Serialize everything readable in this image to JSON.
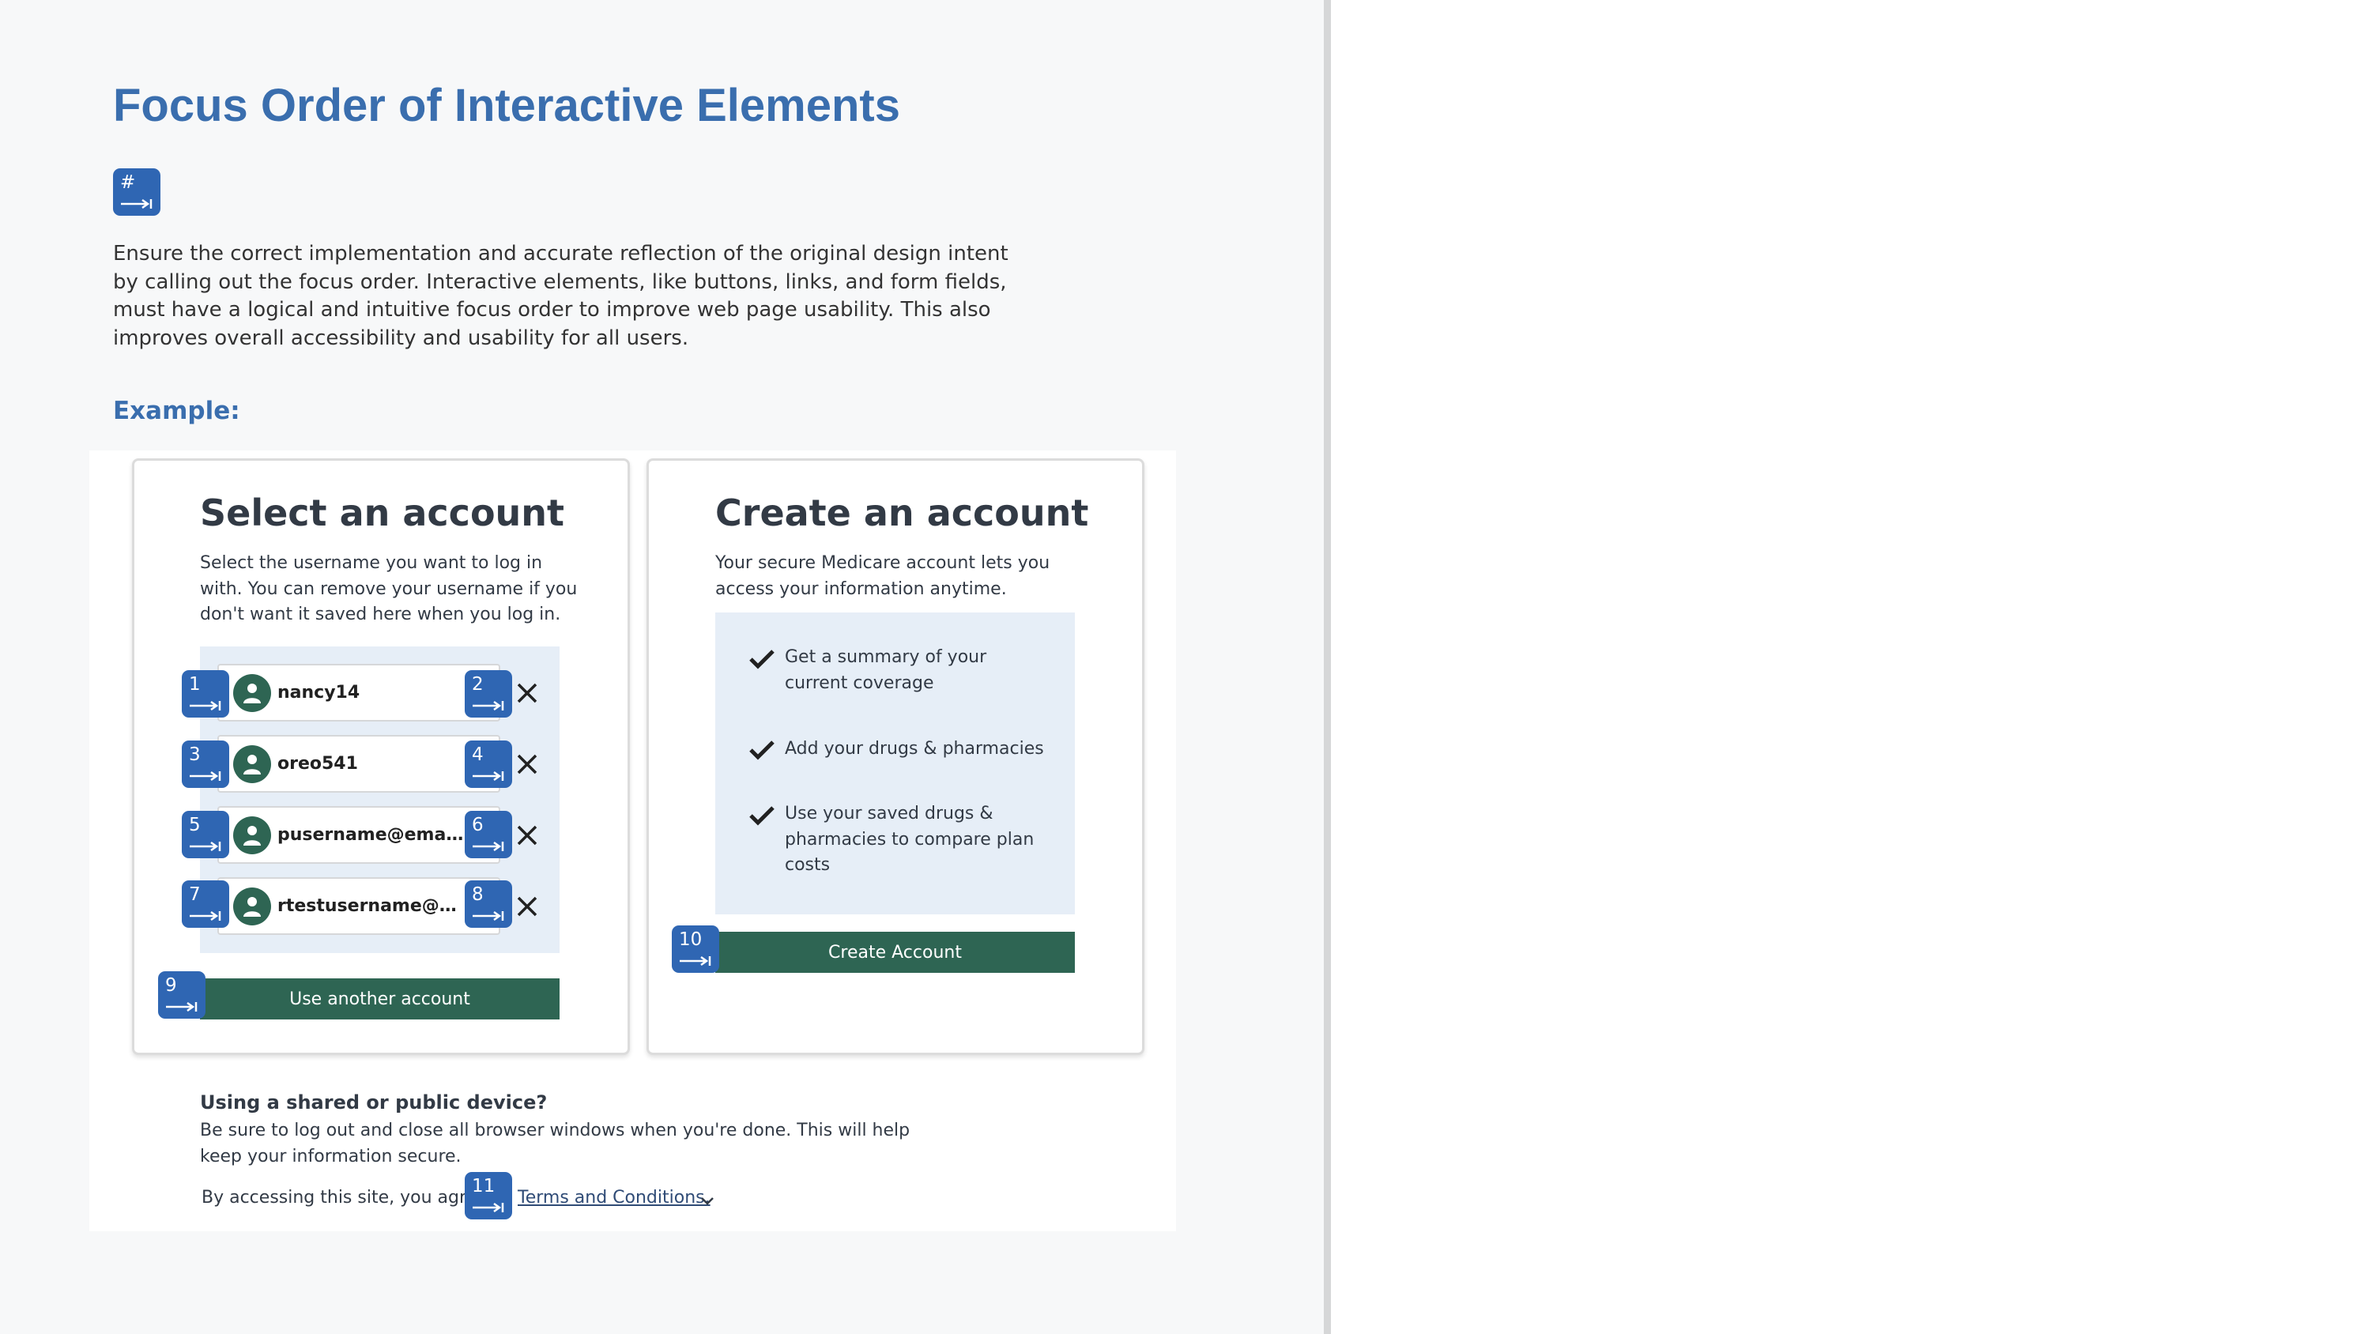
{
  "page": {
    "title": "Focus Order of Interactive Elements",
    "legend_badge": "#",
    "intro": "Ensure the correct implementation and accurate reflection of the original design intent by calling out the focus order. Interactive elements, like buttons, links, and form fields, must have a logical and intuitive focus order to improve web page usability. This also improves overall accessibility and usability for all users.",
    "example_label": "Example:"
  },
  "select_account": {
    "title": "Select an account",
    "description": "Select the username you want to log in with. You can remove your username if you don't want it saved here when you log in.",
    "accounts": [
      {
        "username": "nancy14",
        "focus_select": "1",
        "focus_remove": "2"
      },
      {
        "username": "oreo541",
        "focus_select": "3",
        "focus_remove": "4"
      },
      {
        "username": "pusername@email.com",
        "focus_select": "5",
        "focus_remove": "6"
      },
      {
        "username": "rtestusername@gmail.com",
        "focus_select": "7",
        "focus_remove": "8"
      }
    ],
    "another_button": "Use another account",
    "another_focus": "9"
  },
  "create_account": {
    "title": "Create an account",
    "description": "Your secure Medicare account lets you access your information anytime.",
    "benefits": [
      "Get a summary of your current coverage",
      "Add your drugs & pharmacies",
      "Use your saved drugs & pharmacies to compare plan costs"
    ],
    "button": "Create Account",
    "focus": "10"
  },
  "shared_device": {
    "heading": "Using a shared or public device?",
    "description": "Be sure to log out and close all browser windows when you're done. This will help keep your information secure.",
    "agree_text": "By accessing this site, you agree",
    "terms_link": "Terms and Conditions.",
    "terms_focus": "11"
  },
  "colors": {
    "title_blue": "#3a6eae",
    "badge_blue": "#2f66b3",
    "button_green": "#2e6553",
    "panel_bg": "#e6eef7"
  },
  "icons": {
    "focus_badge": "tab-arrow-icon",
    "avatar": "user-icon",
    "remove": "close-icon",
    "benefit": "checkmark-icon",
    "terms": "chevron-down-icon"
  }
}
